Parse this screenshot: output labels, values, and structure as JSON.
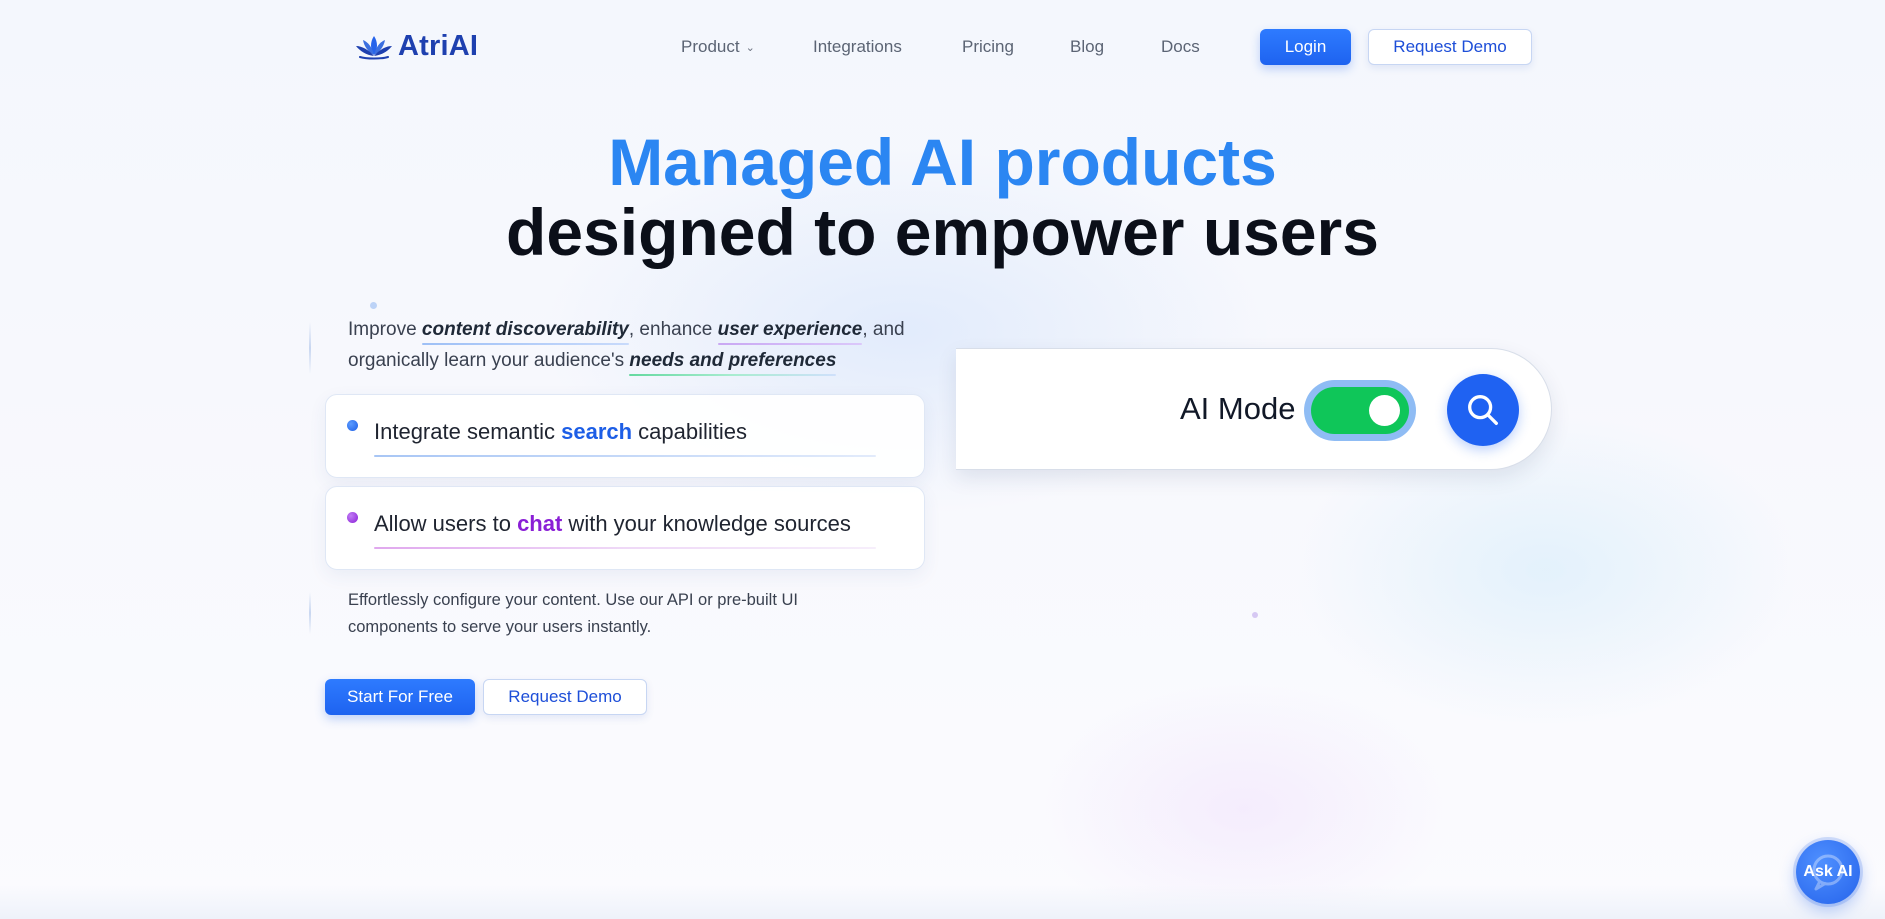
{
  "nav": {
    "logo_text": "AtriAI",
    "links": [
      {
        "label": "Product"
      },
      {
        "label": "Integrations"
      },
      {
        "label": "Pricing"
      },
      {
        "label": "Blog"
      },
      {
        "label": "Docs"
      }
    ],
    "login_label": "Login",
    "request_demo_label": "Request Demo"
  },
  "hero": {
    "headline_line1": "Managed AI products",
    "headline_line2": "designed to empower users",
    "intro": {
      "part1": "Improve ",
      "kw1": "content discoverability",
      "part2": ", enhance ",
      "kw2": "user experience",
      "part3": ", and organically learn your audience's ",
      "kw3": "needs and preferences"
    },
    "features": [
      {
        "prefix": "Integrate semantic ",
        "highlight": "search",
        "suffix": " capabilities",
        "color": "#1d5ee6"
      },
      {
        "prefix": "Allow users to ",
        "highlight": "chat",
        "suffix": " with your knowledge sources",
        "color": "#8a1fd6"
      }
    ],
    "description": "Effortlessly configure your content. Use our API or pre-built UI components to serve your users instantly.",
    "start_label": "Start For Free",
    "request_demo_label": "Request Demo"
  },
  "search_bar": {
    "ai_mode_label": "AI Mode",
    "ai_mode_on": true,
    "search_icon": "search-icon"
  },
  "ask_ai": {
    "label": "Ask AI",
    "icon": "chat-bubble-icon"
  },
  "colors": {
    "primary": "#1f62f2",
    "headline_accent": "#2b86f2",
    "toggle_on": "#0fc659",
    "chat_accent": "#8a1fd6"
  }
}
